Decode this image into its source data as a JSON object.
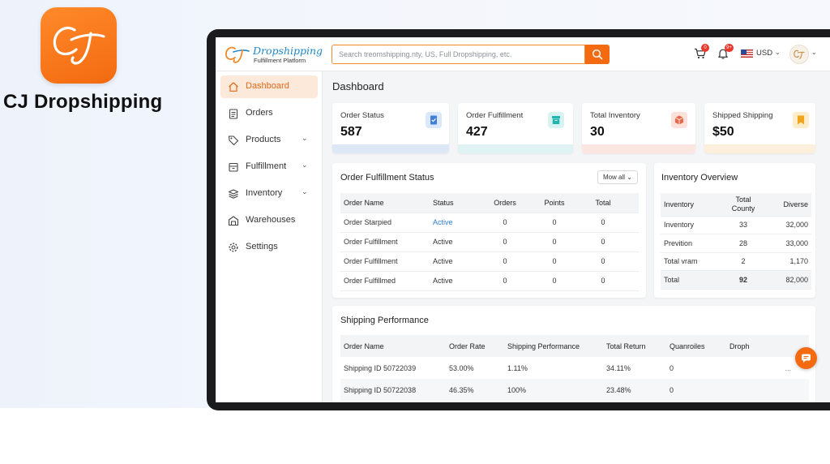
{
  "promo": {
    "brand_name": "CJ Dropshipping",
    "app_icon_text": "CJ",
    "accent": "#f36a10"
  },
  "header": {
    "logo_title": "Dropshipping",
    "logo_subtitle": "Fulfillment Platform",
    "search_placeholder": "Search treomshipping.nty, US, Full Dropshipping, etc.",
    "cart_badge": "0",
    "notif_badge": "9+",
    "currency": "USD",
    "icons": [
      "search-icon",
      "cart-icon",
      "bell-icon",
      "flag-us-icon",
      "avatar"
    ]
  },
  "sidebar": {
    "items": [
      {
        "label": "Dashboard",
        "icon": "home-icon",
        "active": true
      },
      {
        "label": "Orders",
        "icon": "clipboard-icon"
      },
      {
        "label": "Products",
        "icon": "tag-icon",
        "expandable": true
      },
      {
        "label": "Fulfillment",
        "icon": "box-icon",
        "expandable": true
      },
      {
        "label": "Inventory",
        "icon": "stack-icon",
        "expandable": true
      },
      {
        "label": "Warehouses",
        "icon": "warehouse-icon"
      },
      {
        "label": "Settings",
        "icon": "gear-icon"
      }
    ]
  },
  "main": {
    "title": "Dashboard",
    "stats": [
      {
        "title": "Order Status",
        "value": "587",
        "icon": "checklist-icon",
        "color": "#3f7fd8",
        "bar": "#dde8f7"
      },
      {
        "title": "Order Fulfillment",
        "value": "427",
        "icon": "archive-icon",
        "color": "#1fb5b0",
        "bar": "#e0f3f4"
      },
      {
        "title": "Total Inventory",
        "value": "30",
        "icon": "cube-icon",
        "color": "#e8684a",
        "bar": "#fbe6e1"
      },
      {
        "title": "Shipped Shipping",
        "value": "$50",
        "icon": "bookmark-icon",
        "color": "#f2a51a",
        "bar": "#fcf0dc"
      }
    ],
    "fulfillment": {
      "title": "Order Fulfillment Status",
      "filter": "Mow all",
      "columns": [
        "Order Name",
        "Status",
        "Orders",
        "Points",
        "Total"
      ],
      "rows": [
        [
          "Order Starpied",
          "Active",
          "0",
          "0",
          "0"
        ],
        [
          "Order Fulfillment",
          "Active",
          "0",
          "0",
          "0"
        ],
        [
          "Order Fulfillment",
          "Active",
          "0",
          "0",
          "0"
        ],
        [
          "Order Fulfillmed",
          "Active",
          "0",
          "0",
          "0"
        ]
      ]
    },
    "inventory": {
      "title": "Inventory Overview",
      "columns": [
        "Inventory",
        "Total County",
        "Diverse"
      ],
      "rows": [
        [
          "Inventory",
          "33",
          "32,000"
        ],
        [
          "Prevition",
          "28",
          "33,000"
        ],
        [
          "Total vram",
          "2",
          "1,170"
        ],
        [
          "Total",
          "92",
          "82,000"
        ]
      ]
    },
    "shipping": {
      "title": "Shipping Performance",
      "columns": [
        "Order Name",
        "Order Rate",
        "Shipping Performance",
        "Total Return",
        "Quanroiles",
        "Droph"
      ],
      "rows": [
        [
          "Shipping ID 50722039",
          "53.00%",
          "1.11%",
          "34.11%",
          "0",
          "..."
        ],
        [
          "Shipping ID 50722038",
          "46.35%",
          "100%",
          "23.48%",
          "0",
          ""
        ]
      ]
    }
  }
}
